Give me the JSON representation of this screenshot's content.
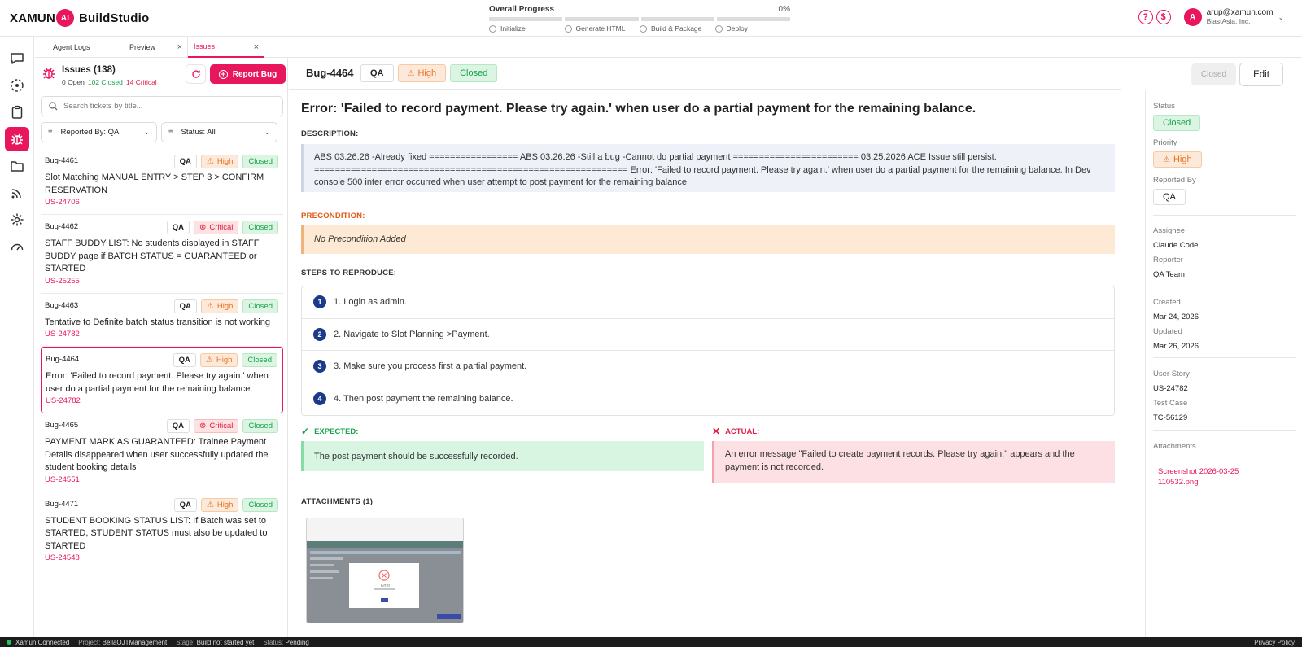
{
  "header": {
    "brand": "XAMUN",
    "brand_ai": "AI",
    "app_name": "BuildStudio",
    "progress_label": "Overall Progress",
    "progress_percent": "0%",
    "progress_value": 0,
    "steps": [
      "Initialize",
      "Generate HTML",
      "Build & Package",
      "Deploy"
    ],
    "user_initial": "A",
    "user_email": "arup@xamun.com",
    "user_org": "BlastAsia, Inc."
  },
  "tabs": [
    {
      "label": "Agent Logs",
      "closable": false
    },
    {
      "label": "Preview",
      "closable": true
    },
    {
      "label": "Issues",
      "closable": true,
      "active": true
    }
  ],
  "issues_panel": {
    "title": "Issues (138)",
    "open": "0 Open",
    "closed": "102 Closed",
    "critical": "14 Critical",
    "report_button": "Report Bug",
    "search_placeholder": "Search tickets by title...",
    "filter_reported": "Reported By: QA",
    "filter_status": "Status: All",
    "items": [
      {
        "id": "Bug-4461",
        "reporter": "QA",
        "priority": "High",
        "status": "Closed",
        "title": "Slot Matching MANUAL ENTRY > STEP 3 > CONFIRM RESERVATION",
        "story": "US-24706"
      },
      {
        "id": "Bug-4462",
        "reporter": "QA",
        "priority": "Critical",
        "status": "Closed",
        "title": "STAFF BUDDY LIST: No students displayed in STAFF BUDDY page if BATCH STATUS = GUARANTEED or STARTED",
        "story": "US-25255"
      },
      {
        "id": "Bug-4463",
        "reporter": "QA",
        "priority": "High",
        "status": "Closed",
        "title": "Tentative to Definite batch status transition is not working",
        "story": "US-24782"
      },
      {
        "id": "Bug-4464",
        "reporter": "QA",
        "priority": "High",
        "status": "Closed",
        "title": "Error: 'Failed to record payment. Please try again.' when user do a partial payment for the remaining balance.",
        "story": "US-24782",
        "selected": true
      },
      {
        "id": "Bug-4465",
        "reporter": "QA",
        "priority": "Critical",
        "status": "Closed",
        "title": "PAYMENT MARK AS GUARANTEED: Trainee Payment Details disappeared when user successfully updated the student booking details",
        "story": "US-24551"
      },
      {
        "id": "Bug-4471",
        "reporter": "QA",
        "priority": "High",
        "status": "Closed",
        "title": "STUDENT BOOKING STATUS LIST: If Batch was set to STARTED, STUDENT STATUS must also be updated to STARTED",
        "story": "US-24548"
      }
    ]
  },
  "detail": {
    "id": "Bug-4464",
    "reporter": "QA",
    "priority": "High",
    "status": "Closed",
    "closed_button": "Closed",
    "edit_button": "Edit",
    "title": "Error: 'Failed to record payment. Please try again.' when user do a partial payment for the remaining balance.",
    "description_label": "DESCRIPTION:",
    "description": "ABS 03.26.26 -Already fixed ================= ABS 03.26.26 -Still a bug -Cannot do partial payment ======================== 03.25.2026 ACE Issue still persist. ============================================================ Error: 'Failed to record payment. Please try again.' when user do a partial payment for the remaining balance. In Dev console 500 inter error occurred when user attempt to post payment for the remaining balance.",
    "precondition_label": "PRECONDITION:",
    "precondition": "No Precondition Added",
    "steps_label": "STEPS TO REPRODUCE:",
    "steps": [
      {
        "n": "1",
        "text": "1. Login as admin."
      },
      {
        "n": "2",
        "text": "2. Navigate to Slot Planning >Payment."
      },
      {
        "n": "3",
        "text": "3. Make sure you process first a partial payment."
      },
      {
        "n": "4",
        "text": "4. Then post payment the remaining balance."
      }
    ],
    "expected_label": "EXPECTED:",
    "expected": "The post payment should be successfully recorded.",
    "actual_label": "ACTUAL:",
    "actual": "An error message \"Failed to create payment records. Please try again.\" appears and the payment is not recorded.",
    "attachments_label": "ATTACHMENTS (1)",
    "thumb_error_title": "Error"
  },
  "side": {
    "status_label": "Status",
    "status": "Closed",
    "priority_label": "Priority",
    "priority": "High",
    "reported_by_label": "Reported By",
    "reported_by": "QA",
    "assignee_label": "Assignee",
    "assignee": "Claude Code",
    "reporter_label": "Reporter",
    "reporter": "QA Team",
    "created_label": "Created",
    "created": "Mar 24, 2026",
    "updated_label": "Updated",
    "updated": "Mar 26, 2026",
    "user_story_label": "User Story",
    "user_story": "US-24782",
    "test_case_label": "Test Case",
    "test_case": "TC-56129",
    "attachments_label": "Attachments",
    "attachment_name": "Screenshot 2026-03-25 110532.png"
  },
  "statusbar": {
    "connected": "Xamun Connected",
    "project_label": "Project:",
    "project": "BellaOJTManagement",
    "stage_label": "Stage:",
    "stage": "Build not started yet",
    "status_label": "Status:",
    "status": "Pending",
    "privacy": "Privacy Policy"
  },
  "colors": {
    "accent": "#e8175d",
    "high": "#e8711d",
    "critical": "#e11d48",
    "closed": "#16a34a",
    "step_badge": "#1d3a8a"
  },
  "icons": {
    "rail": [
      "chat-icon",
      "dashed-circle-icon",
      "clipboard-icon",
      "bug-icon",
      "folder-icon",
      "broadcast-icon",
      "gear-icon",
      "speedometer-icon"
    ],
    "help": "help-icon",
    "billing": "dollar-icon"
  }
}
